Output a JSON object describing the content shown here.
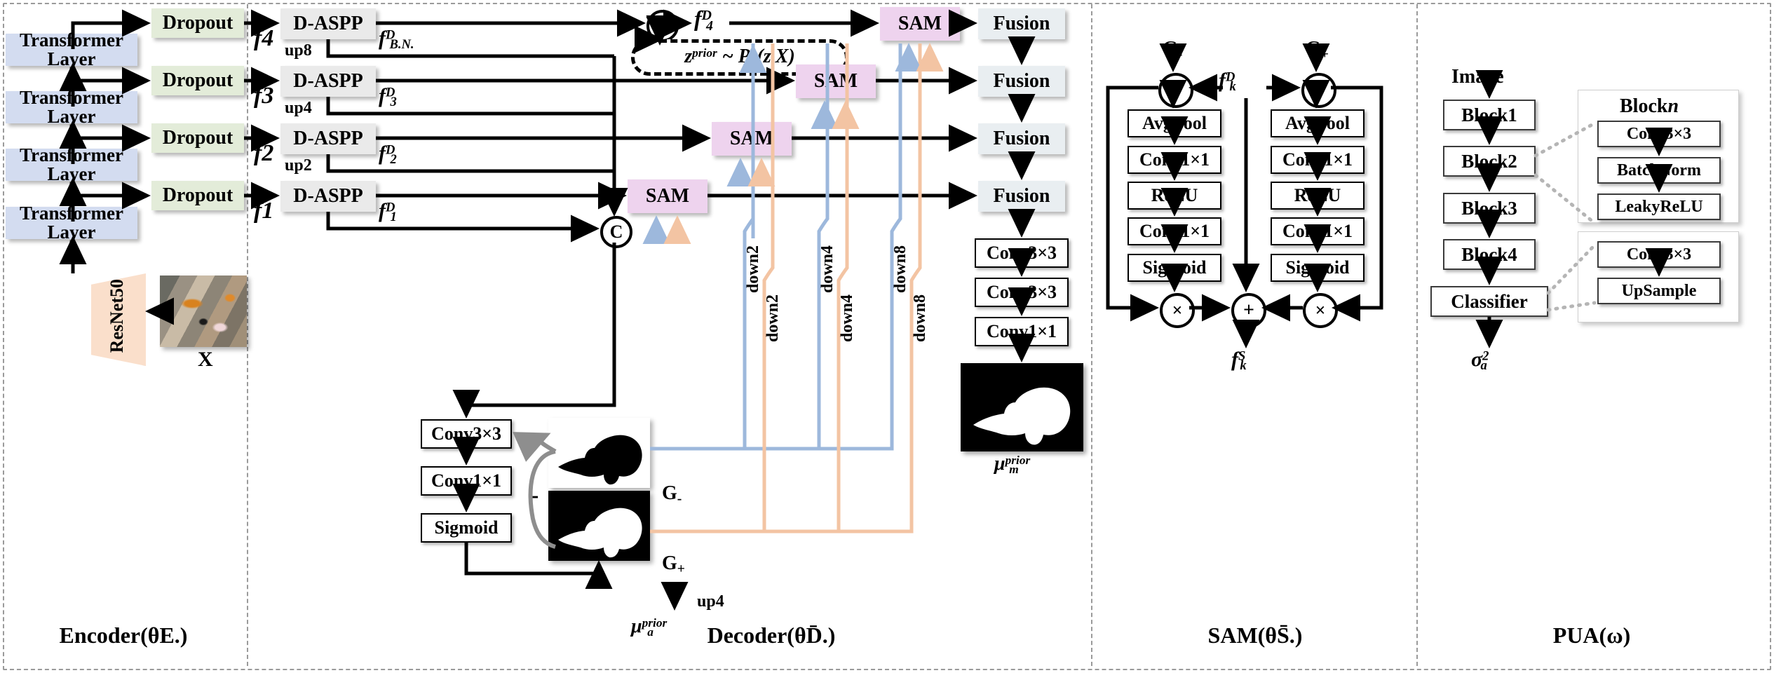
{
  "colors": {
    "transformer": "#d3dcf0",
    "dropout": "#e3ecd9",
    "daspp": "#eaeaea",
    "sam": "#eed3ee",
    "fusion": "#e9eef1",
    "resnet": "#fadfcb",
    "gminus_line": "#9db8dc",
    "gplus_line": "#f3c4a3",
    "panel_divider": "#9a9a9a"
  },
  "panels": {
    "encoder": {
      "caption": "Encoder(θE.)"
    },
    "decoder": {
      "caption": "Decoder(θD̄.)"
    },
    "sam": {
      "caption": "SAM(θS̄.)"
    },
    "pua": {
      "caption": "PUA(ω)"
    }
  },
  "encoder": {
    "transformer_layers": [
      {
        "label": "Transformer Layer"
      },
      {
        "label": "Transformer Layer"
      },
      {
        "label": "Transformer Layer"
      },
      {
        "label": "Transformer Layer"
      }
    ],
    "dropouts": [
      {
        "label": "Dropout"
      },
      {
        "label": "Dropout"
      },
      {
        "label": "Dropout"
      },
      {
        "label": "Dropout"
      }
    ],
    "backbone": {
      "label": "ResNet50"
    },
    "input_image": {
      "label": "X",
      "description": "underwater camouflaged fish scene"
    }
  },
  "decoder": {
    "feature_inputs": [
      {
        "label": "f4"
      },
      {
        "label": "f3"
      },
      {
        "label": "f2"
      },
      {
        "label": "f1"
      }
    ],
    "aspp_blocks": [
      {
        "label": "D-ASPP",
        "up": "up8",
        "out": "fB.N.D"
      },
      {
        "label": "D-ASPP",
        "up": "up4",
        "out": "f3D"
      },
      {
        "label": "D-ASPP",
        "up": "up2",
        "out": "f2D"
      },
      {
        "label": "D-ASPP",
        "up": "",
        "out": "f1D"
      }
    ],
    "concat_symbol": "C",
    "latent_out": "f4D",
    "prior": "zprior ~ Pπ(z|X)",
    "sam_blocks": [
      {
        "label": "SAM"
      },
      {
        "label": "SAM"
      },
      {
        "label": "SAM"
      },
      {
        "label": "SAM"
      }
    ],
    "fusion_blocks": [
      {
        "label": "Fusion"
      },
      {
        "label": "Fusion"
      },
      {
        "label": "Fusion"
      },
      {
        "label": "Fusion"
      }
    ],
    "head_convs": [
      {
        "label": "Conv3×3"
      },
      {
        "label": "Conv3×3"
      },
      {
        "label": "Conv1×1"
      }
    ],
    "output_map_label": "μmprior",
    "prior_branch": [
      {
        "label": "Conv3×3"
      },
      {
        "label": "Conv1×1"
      },
      {
        "label": "Sigmoid"
      }
    ],
    "minus_symbol": "-",
    "gminus_label": "G-",
    "gplus_label": "G+",
    "up4_label": "up4",
    "mu_a_label": "μaprior",
    "down_labels_gminus": [
      "down2",
      "down4",
      "down8"
    ],
    "down_labels_gplus": [
      "down2",
      "down4",
      "down8"
    ]
  },
  "sam_module": {
    "input_gminus": "G-",
    "input_gplus": "G+",
    "feature_label": "fkD",
    "output_label": "fkS",
    "mul_symbol": "×",
    "add_symbol": "+",
    "left_branch": [
      {
        "label": "AvgPool"
      },
      {
        "label": "Conv1×1"
      },
      {
        "label": "ReLU"
      },
      {
        "label": "Conv1×1"
      },
      {
        "label": "Sigmoid"
      }
    ],
    "right_branch": [
      {
        "label": "AvgPool"
      },
      {
        "label": "Conv1×1"
      },
      {
        "label": "ReLU"
      },
      {
        "label": "Conv1×1"
      },
      {
        "label": "Sigmoid"
      }
    ]
  },
  "pua_module": {
    "input_label": "Image",
    "blocks": [
      {
        "label": "Block1"
      },
      {
        "label": "Block2"
      },
      {
        "label": "Block3"
      },
      {
        "label": "Block4"
      },
      {
        "label": "Classifier"
      }
    ],
    "output_label": "σa2",
    "blockn_title": "Blockn",
    "blockn_items": [
      {
        "label": "Conv3×3"
      },
      {
        "label": "BatchNorm"
      },
      {
        "label": "LeakyReLU"
      }
    ],
    "classifier_items": [
      {
        "label": "Conv3×3"
      },
      {
        "label": "UpSample"
      }
    ]
  }
}
